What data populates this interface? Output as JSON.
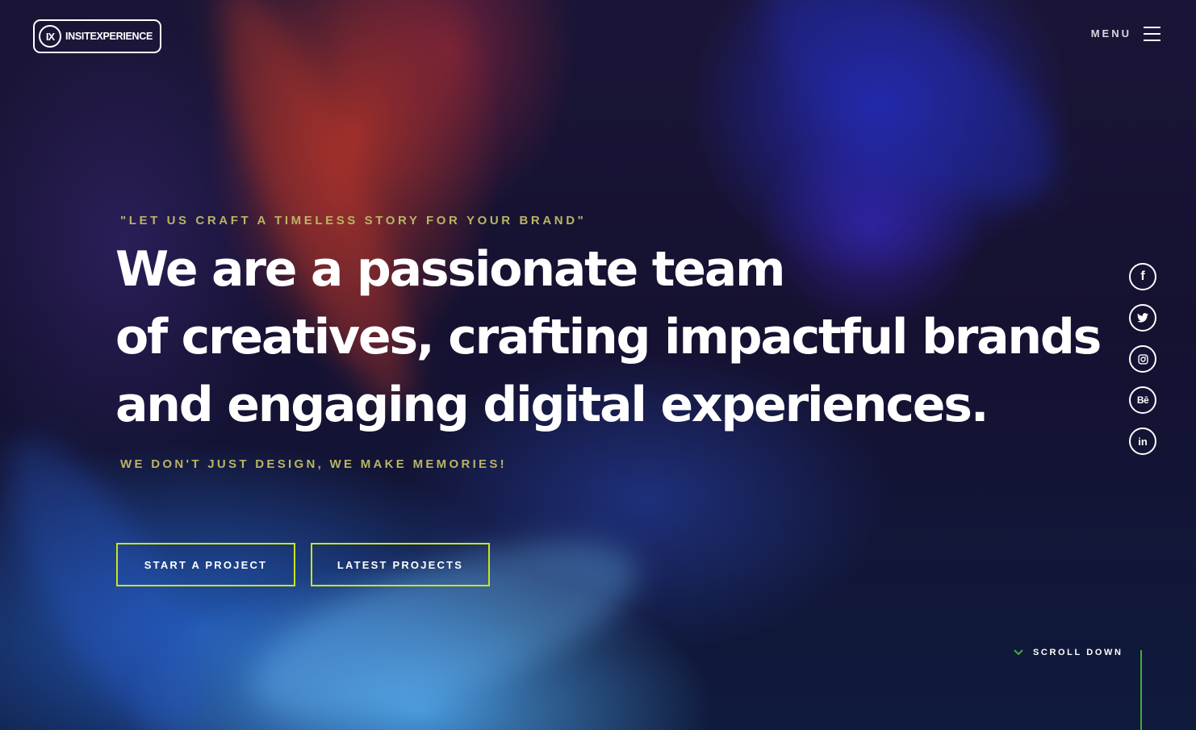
{
  "header": {
    "logo_mark": "IX",
    "logo_text": "INSITEXPERIENCE",
    "menu_label": "MENU"
  },
  "hero": {
    "tagline": "\"LET US CRAFT A TIMELESS STORY FOR YOUR BRAND\"",
    "headline_lines": [
      "We are a passionate team",
      "of creatives, crafting impactful brands",
      "and engaging digital experiences."
    ],
    "subline": "WE DON'T JUST DESIGN, WE MAKE MEMORIES!"
  },
  "buttons": {
    "start_project": "START A PROJECT",
    "latest_projects": "LATEST PROJECTS"
  },
  "social": {
    "items": [
      {
        "icon": "facebook-icon",
        "glyph": "f"
      },
      {
        "icon": "twitter-icon",
        "glyph": ""
      },
      {
        "icon": "instagram-icon",
        "glyph": ""
      },
      {
        "icon": "behance-icon",
        "glyph": "Bē"
      },
      {
        "icon": "linkedin-icon",
        "glyph": "in"
      }
    ]
  },
  "scroll": {
    "label": "SCROLL DOWN"
  },
  "colors": {
    "accent_text": "#b9b563",
    "button_border": "#c7e51c",
    "scroll_accent": "#3fae3a"
  }
}
